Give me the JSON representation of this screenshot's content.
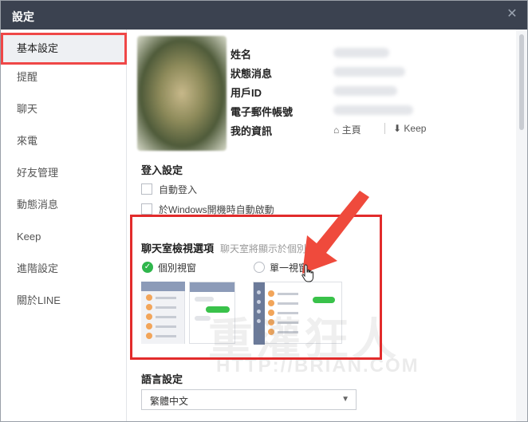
{
  "window": {
    "title": "設定",
    "close_icon": "close-icon"
  },
  "sidebar": {
    "items": [
      {
        "label": "基本設定",
        "active": true
      },
      {
        "label": "提醒"
      },
      {
        "label": "聊天"
      },
      {
        "label": "來電"
      },
      {
        "label": "好友管理"
      },
      {
        "label": "動態消息"
      },
      {
        "label": "Keep"
      },
      {
        "label": "進階設定"
      },
      {
        "label": "關於LINE"
      }
    ]
  },
  "profile": {
    "name_label": "姓名",
    "status_label": "狀態消息",
    "userid_label": "用戶ID",
    "email_label": "電子郵件帳號",
    "myinfo_label": "我的資訊",
    "home_link": "主頁",
    "keep_link": "Keep"
  },
  "login": {
    "title": "登入設定",
    "auto_login": "自動登入",
    "auto_start": "於Windows開機時自動啟動"
  },
  "chat_window": {
    "title": "聊天室檢視選項",
    "description": "聊天室將顯示於個別",
    "option_separate": "個別視窗",
    "option_single": "單一視窗",
    "selected": "個別視窗"
  },
  "language": {
    "title": "語言設定",
    "selected": "繁體中文"
  },
  "watermark": {
    "text": "重灌狂人",
    "url": "HTTP://BRIAN.COM"
  },
  "colors": {
    "highlight": "#e22b2b",
    "accent_green": "#2fb64c",
    "titlebar": "#3b4250"
  }
}
